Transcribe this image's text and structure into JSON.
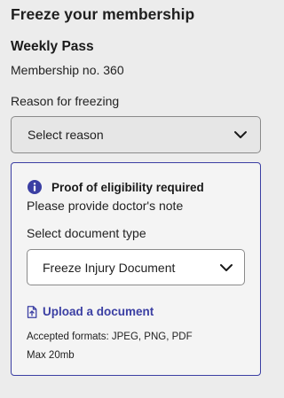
{
  "header": {
    "title": "Freeze your membership"
  },
  "membership": {
    "plan_name": "Weekly Pass",
    "number_text": "Membership no. 360"
  },
  "reason": {
    "label": "Reason for freezing",
    "selected_value": "Select reason"
  },
  "eligibility_card": {
    "title": "Proof of eligibility required",
    "subtitle": "Please provide doctor's note",
    "document_type_label": "Select document type",
    "document_type_value": "Freeze Injury Document",
    "upload_label": "Upload a document",
    "accepted_formats": "Accepted formats: JPEG, PNG, PDF",
    "max_size": "Max 20mb"
  },
  "icons": {
    "info": "info-icon",
    "chevron": "chevron-down-icon",
    "upload": "upload-file-icon"
  },
  "colors": {
    "accent": "#3b3fa3",
    "background": "#ececec",
    "text": "#1a1a1a"
  }
}
